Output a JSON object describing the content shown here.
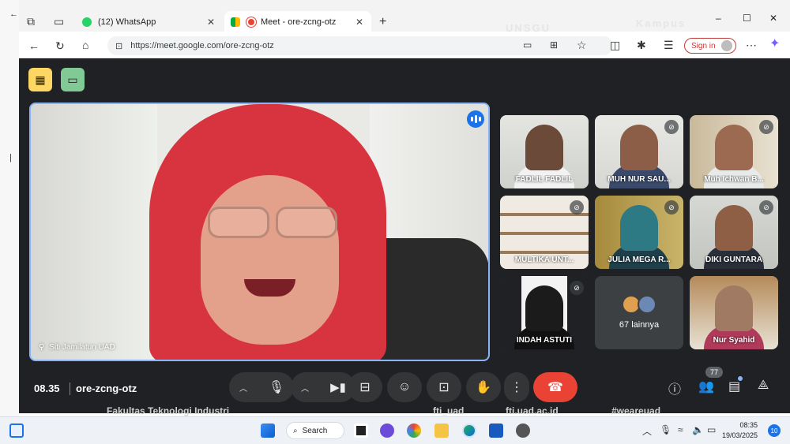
{
  "browser": {
    "tabs": [
      {
        "label": "(12) WhatsApp",
        "favicon_color": "#25d366"
      },
      {
        "label": "Meet - ore-zcng-otz",
        "favicon_color": "#ea4335"
      }
    ],
    "new_tab_symbol": "+",
    "url": "https://meet.google.com/ore-zcng-otz",
    "signin_label": "Sign in",
    "window_controls": [
      "–",
      "☐",
      "✕"
    ]
  },
  "meet": {
    "main_speaker": {
      "name": "Siti Jamilatun UAD"
    },
    "participants": [
      {
        "name": "FADLIL FADLIL",
        "muted": false
      },
      {
        "name": "MUH NUR SAU...",
        "muted": true
      },
      {
        "name": "Muh Ichwan B...",
        "muted": true
      },
      {
        "name": "MULTIKA UNT...",
        "muted": true
      },
      {
        "name": "JULIA MEGA R...",
        "muted": true
      },
      {
        "name": "DIKI GUNTARA",
        "muted": true
      },
      {
        "name": "INDAH ASTUTI",
        "muted": true
      },
      {
        "name": "Nur Syahid",
        "muted": false
      }
    ],
    "more_label": "67 lainnya",
    "time": "08.35",
    "meeting_code": "ore-zcng-otz",
    "people_count": "77",
    "controls": {
      "mic_icon": "mic-icon",
      "camera_icon": "camera-icon",
      "captions_icon": "captions-icon",
      "emoji_icon": "emoji-icon",
      "present_icon": "present-icon",
      "raise_hand_icon": "raise-hand-icon",
      "more_icon": "more-vert-icon",
      "end_call_icon": "end-call-icon"
    },
    "accent_color": "#8ab4f8",
    "end_call_color": "#ea4335"
  },
  "footer_overlay": {
    "left_text": "Fakultas Teknologi Industri",
    "handle": "fti_uad",
    "site": "fti.uad.ac.id",
    "hashtag": "#weareuad"
  },
  "taskbar": {
    "search_label": "Search",
    "time": "08:35",
    "date": "19/03/2025",
    "notification_count": "10"
  }
}
